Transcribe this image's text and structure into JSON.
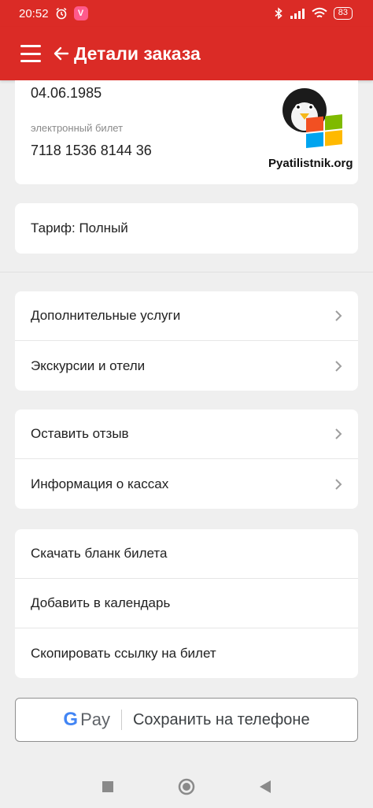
{
  "status_bar": {
    "time": "20:52",
    "app_badge": "V",
    "battery": "83"
  },
  "header": {
    "title": "Детали заказа"
  },
  "passenger": {
    "birth_date": "04.06.1985",
    "ticket_label": "электронный билет",
    "ticket_number": "7118 1536 8144 36"
  },
  "watermark": {
    "text": "Pyatilistnik.org"
  },
  "tariff": {
    "label": "Тариф: Полный"
  },
  "group1": [
    {
      "label": "Дополнительные услуги"
    },
    {
      "label": "Экскурсии и отели"
    }
  ],
  "group2": [
    {
      "label": "Оставить отзыв"
    },
    {
      "label": "Информация о кассах"
    }
  ],
  "group3": [
    {
      "label": "Скачать бланк билета"
    },
    {
      "label": "Добавить в календарь"
    },
    {
      "label": "Скопировать ссылку на билет"
    }
  ],
  "gpay": {
    "brand": "Pay",
    "label": "Сохранить на телефоне"
  },
  "colors": {
    "primary": "#db2b26",
    "background": "#efefef"
  }
}
